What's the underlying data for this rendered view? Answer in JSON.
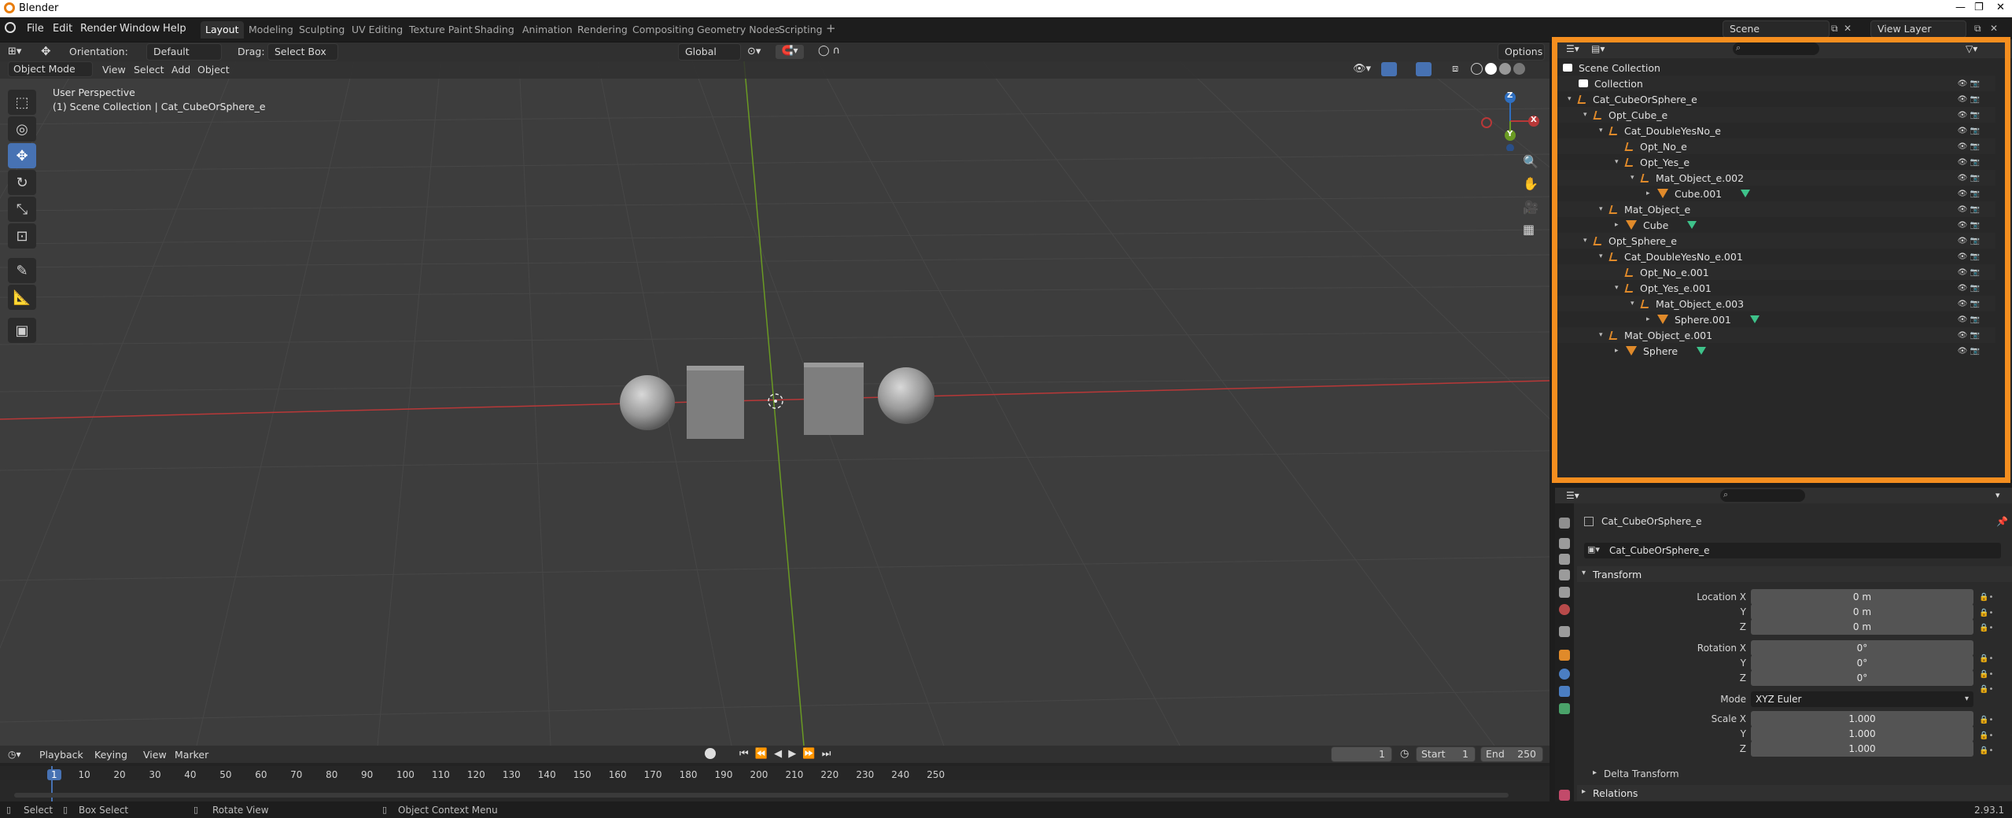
{
  "window": {
    "title": "Blender"
  },
  "menu": [
    "File",
    "Edit",
    "Render",
    "Window",
    "Help"
  ],
  "workspaces": [
    "Layout",
    "Modeling",
    "Sculpting",
    "UV Editing",
    "Texture Paint",
    "Shading",
    "Animation",
    "Rendering",
    "Compositing",
    "Geometry Nodes",
    "Scripting"
  ],
  "active_workspace": "Layout",
  "scene": {
    "name": "Scene",
    "view_layer": "View Layer"
  },
  "toolbar": {
    "orientation_label": "Orientation:",
    "orientation_value": "Default",
    "drag_label": "Drag:",
    "drag_value": "Select Box",
    "transform_space": "Global",
    "options": "Options"
  },
  "viewport_header": {
    "mode": "Object Mode",
    "menus": [
      "View",
      "Select",
      "Add",
      "Object"
    ]
  },
  "viewport_overlay": {
    "line1": "User Perspective",
    "line2": "(1) Scene Collection | Cat_CubeOrSphere_e"
  },
  "gizmo": {
    "x": "X",
    "y": "Y",
    "z": "Z"
  },
  "outliner": {
    "rows": [
      {
        "label": "Scene Collection",
        "depth": 0,
        "icon": "collection-icon"
      },
      {
        "label": "Collection",
        "depth": 1,
        "icon": "collection-icon"
      },
      {
        "label": "Cat_CubeOrSphere_e",
        "depth": 1,
        "icon": "empty-icon"
      },
      {
        "label": "Opt_Cube_e",
        "depth": 2,
        "icon": "empty-icon"
      },
      {
        "label": "Cat_DoubleYesNo_e",
        "depth": 3,
        "icon": "empty-icon"
      },
      {
        "label": "Opt_No_e",
        "depth": 4,
        "icon": "empty-icon"
      },
      {
        "label": "Opt_Yes_e",
        "depth": 4,
        "icon": "empty-icon"
      },
      {
        "label": "Mat_Object_e.002",
        "depth": 5,
        "icon": "empty-icon"
      },
      {
        "label": "Cube.001",
        "depth": 6,
        "icon": "mesh-icon"
      },
      {
        "label": "Mat_Object_e",
        "depth": 3,
        "icon": "empty-icon"
      },
      {
        "label": "Cube",
        "depth": 4,
        "icon": "mesh-icon"
      },
      {
        "label": "Opt_Sphere_e",
        "depth": 2,
        "icon": "empty-icon"
      },
      {
        "label": "Cat_DoubleYesNo_e.001",
        "depth": 3,
        "icon": "empty-icon"
      },
      {
        "label": "Opt_No_e.001",
        "depth": 4,
        "icon": "empty-icon"
      },
      {
        "label": "Opt_Yes_e.001",
        "depth": 4,
        "icon": "empty-icon"
      },
      {
        "label": "Mat_Object_e.003",
        "depth": 5,
        "icon": "empty-icon"
      },
      {
        "label": "Sphere.001",
        "depth": 6,
        "icon": "mesh-icon"
      },
      {
        "label": "Mat_Object_e.001",
        "depth": 3,
        "icon": "empty-icon"
      },
      {
        "label": "Sphere",
        "depth": 4,
        "icon": "mesh-icon"
      }
    ]
  },
  "properties": {
    "object_name": "Cat_CubeOrSphere_e",
    "object_field": "Cat_CubeOrSphere_e",
    "transform_header": "Transform",
    "location_label": "Location X",
    "location": [
      "0 m",
      "0 m",
      "0 m"
    ],
    "rotation_label": "Rotation X",
    "rotation": [
      "0°",
      "0°",
      "0°"
    ],
    "mode_label": "Mode",
    "mode_value": "XYZ Euler",
    "scale_label": "Scale X",
    "scale": [
      "1.000",
      "1.000",
      "1.000"
    ],
    "axis_y": "Y",
    "axis_z": "Z",
    "delta_transform": "Delta Transform",
    "relations": "Relations"
  },
  "timeline": {
    "menus": [
      "Playback",
      "Keying",
      "View",
      "Marker"
    ],
    "current_frame": "1",
    "start_label": "Start",
    "start": "1",
    "end_label": "End",
    "end": "250",
    "ticks": [
      "1",
      "10",
      "20",
      "30",
      "40",
      "50",
      "60",
      "70",
      "80",
      "90",
      "100",
      "110",
      "120",
      "130",
      "140",
      "150",
      "160",
      "170",
      "180",
      "190",
      "200",
      "210",
      "220",
      "230",
      "240",
      "250"
    ]
  },
  "statusbar": {
    "select": "Select",
    "box_select": "Box Select",
    "rotate_view": "Rotate View",
    "context_menu": "Object Context Menu",
    "version": "2.93.1"
  },
  "colors": {
    "accent": "#4772b3",
    "highlight_border": "#f58e1f",
    "x_axis": "#b83838",
    "y_axis": "#6a9a23",
    "z_axis": "#2f6fc0"
  }
}
